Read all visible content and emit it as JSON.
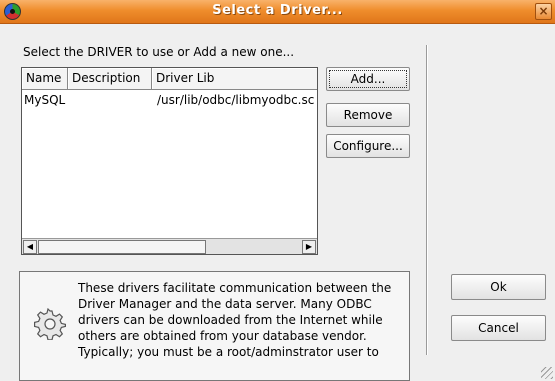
{
  "window": {
    "title": "Select a Driver..."
  },
  "instruction": "Select the DRIVER to use or Add a new one...",
  "list": {
    "columns": [
      "Name",
      "Description",
      "Driver Lib"
    ],
    "rows": [
      {
        "name": "MySQL",
        "description": "",
        "driver_lib": "/usr/lib/odbc/libmyodbc.sc"
      }
    ]
  },
  "buttons": {
    "add": "Add...",
    "remove": "Remove",
    "configure": "Configure...",
    "ok": "Ok",
    "cancel": "Cancel"
  },
  "info": {
    "text": "These drivers facilitate communication between the Driver Manager and the data server. Many ODBC drivers can be downloaded from the Internet while others are obtained from your database vendor. Typically; you must be a root/adminstrator user to"
  },
  "colors": {
    "titlebar": "#ef8d2c",
    "window_bg": "#efefef"
  }
}
